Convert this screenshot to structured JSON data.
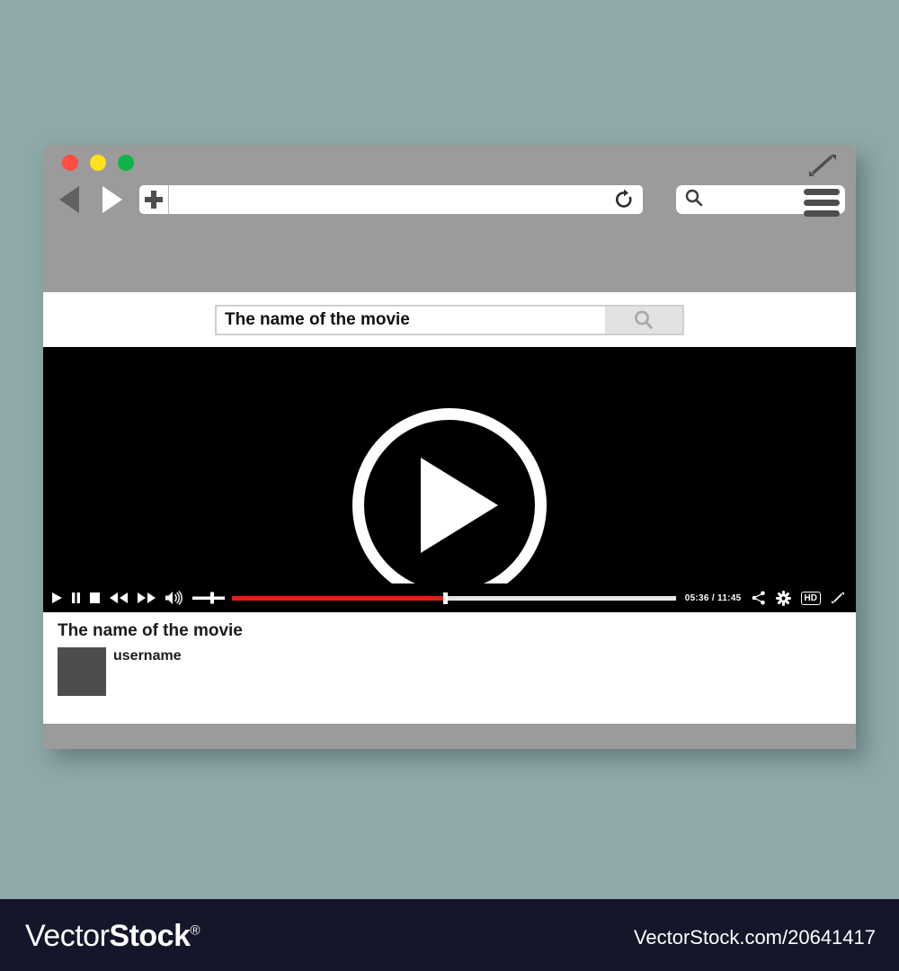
{
  "background_color": "#8fa8a8",
  "browser": {
    "traffic_lights": [
      {
        "name": "close",
        "color": "#ff4e42"
      },
      {
        "name": "minimize",
        "color": "#ffe01e"
      },
      {
        "name": "maximize",
        "color": "#0fb44a"
      }
    ],
    "back_label": "back",
    "forward_label": "forward",
    "new_tab_label": "+",
    "url_value": "",
    "url_placeholder": "",
    "reload_label": "reload",
    "toolbar_search_value": "",
    "toolbar_search_placeholder": "",
    "menu_label": "menu",
    "resize_label": "resize"
  },
  "site_search": {
    "value": "The name of the movie",
    "placeholder": "Search",
    "button_label": "search"
  },
  "player": {
    "big_play_label": "Play",
    "controls": {
      "play": "Play",
      "pause": "Pause",
      "stop": "Stop",
      "rewind": "Rewind",
      "forward": "Fast forward",
      "volume": "Volume",
      "share": "Share",
      "settings": "Settings",
      "quality": "HD",
      "fullscreen": "Fullscreen"
    },
    "time_display": "05:36 / 11:45",
    "current_time": "05:36",
    "duration": "11:45",
    "progress_percent": 48,
    "volume_percent": 55,
    "progress_color": "#e31d1a",
    "track_color": "#e6e6e6"
  },
  "info": {
    "title": "The name of the movie",
    "username": "username",
    "avatar_color": "#4d4d4d"
  },
  "watermark": {
    "logo_thin": "Vector",
    "logo_bold": "Stock",
    "logo_reg": "®",
    "url": "VectorStock.com/20641417"
  }
}
